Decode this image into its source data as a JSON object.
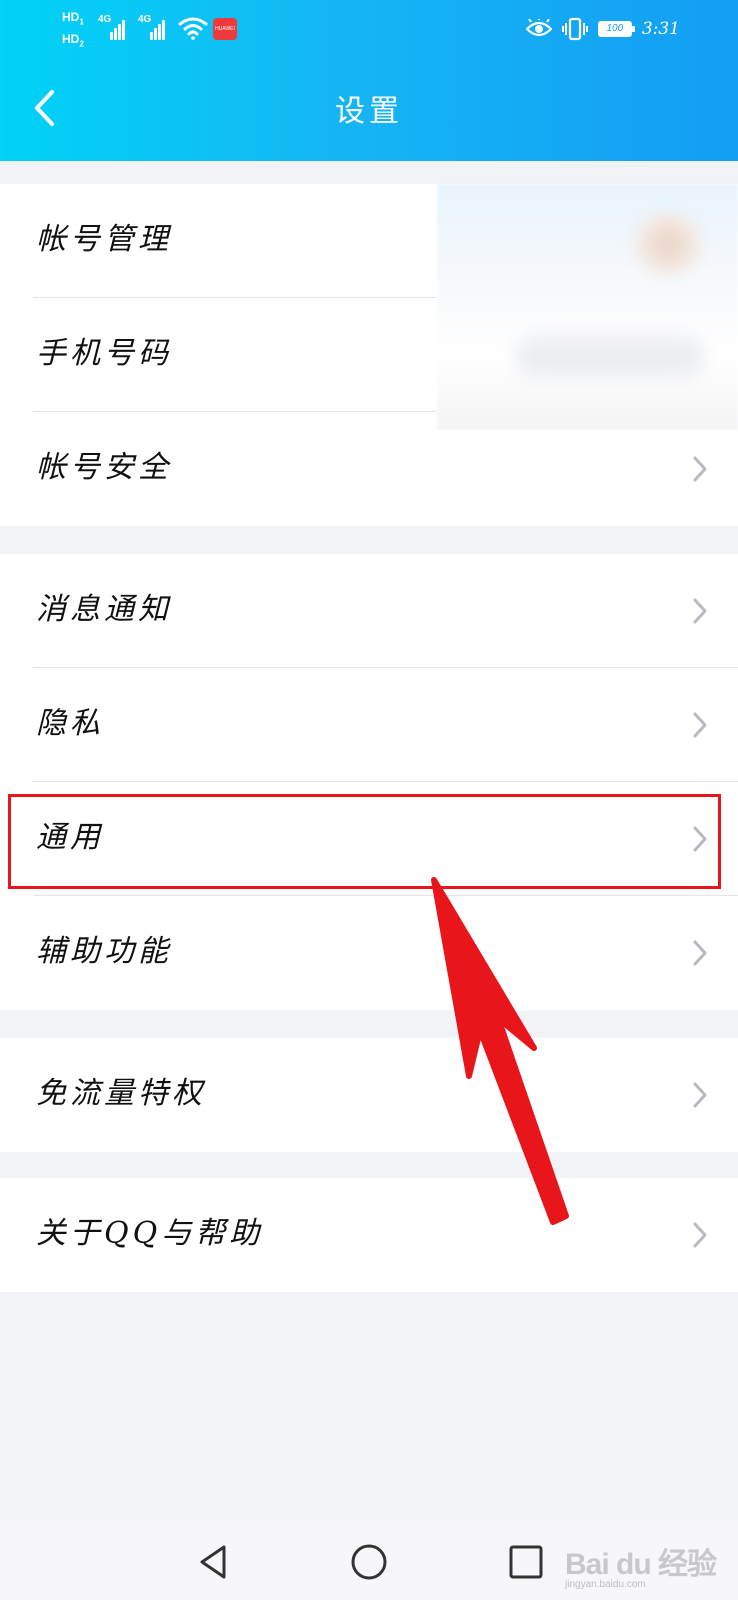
{
  "status_bar": {
    "hd1": "HD",
    "hd1_index": "1",
    "hd2": "HD",
    "hd2_index": "2",
    "network1": "4G",
    "network2": "4G",
    "huawei_badge": "HUAWEI",
    "battery": "100",
    "time": "3:31",
    "icons": [
      "eye-icon",
      "vibrate-icon",
      "battery-icon",
      "wifi-icon",
      "signal-icon"
    ]
  },
  "header": {
    "title": "设置",
    "back_icon": "chevron-left-icon",
    "background_colors": [
      "#00d3f7",
      "#139ef4"
    ]
  },
  "groups": [
    {
      "items": [
        {
          "label": "帐号管理",
          "chevron": false
        },
        {
          "label": "手机号码",
          "chevron": false
        },
        {
          "label": "帐号安全",
          "chevron": true
        }
      ]
    },
    {
      "items": [
        {
          "label": "消息通知",
          "chevron": true
        },
        {
          "label": "隐私",
          "chevron": true
        },
        {
          "label": "通用",
          "chevron": true,
          "highlighted": true
        },
        {
          "label": "辅助功能",
          "chevron": true
        }
      ]
    },
    {
      "items": [
        {
          "label": "免流量特权",
          "chevron": true
        }
      ]
    },
    {
      "items": [
        {
          "label": "关于QQ与帮助",
          "chevron": true
        }
      ]
    }
  ],
  "annotation": {
    "highlight_color": "#e8161a",
    "arrow_color": "#e8161a"
  },
  "nav_bar": {
    "buttons": [
      "back-triangle-icon",
      "home-circle-icon",
      "recents-square-icon"
    ]
  },
  "watermark": {
    "main": "Bai du 经验",
    "sub": "jingyan.baidu.com"
  }
}
